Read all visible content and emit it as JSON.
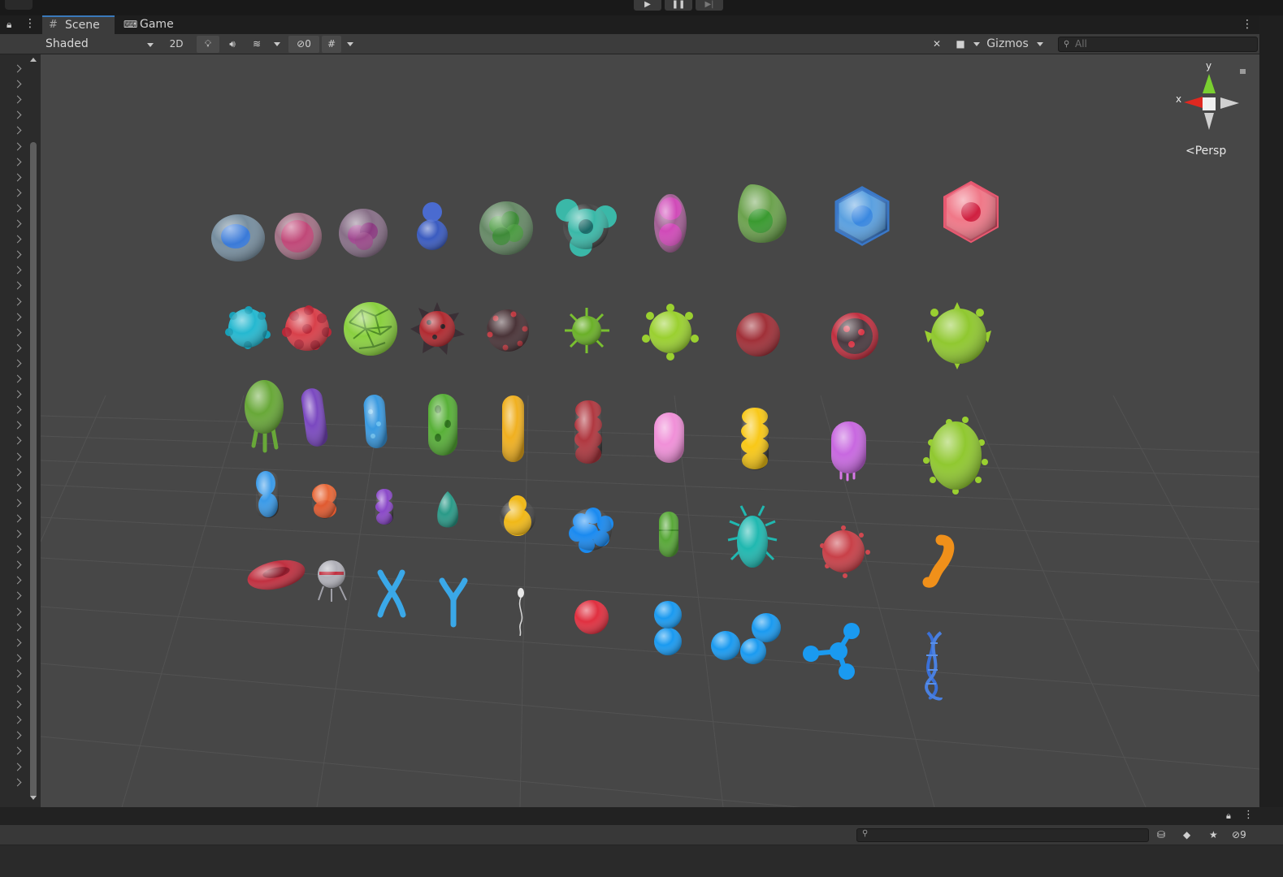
{
  "top": {
    "logo_text": "",
    "play_icons": {
      "play": "play-icon",
      "pause": "pause-icon",
      "step": "step-icon"
    }
  },
  "tabs": [
    {
      "label": "Scene",
      "icon": "grid-icon"
    },
    {
      "label": "Game",
      "icon": "gamepad-icon"
    }
  ],
  "toolbar": {
    "shading_mode": "Shaded",
    "mode_2d": "2D",
    "hidden_count": "0",
    "gizmos_label": "Gizmos",
    "search_placeholder": "All"
  },
  "gizmo": {
    "x_label": "x",
    "y_label": "y",
    "projection": "Persp"
  },
  "bottom": {
    "hidden_count": "9",
    "search_placeholder": ""
  },
  "colors": {
    "accent": "#3a79bb",
    "scene_bg": "#474747",
    "toolbar_bg": "#3c3c3c"
  },
  "scene_objects": [
    {
      "name": "blue-cell",
      "color": "#4a86d8"
    },
    {
      "name": "pink-cell",
      "color": "#d0608a"
    },
    {
      "name": "purple-cell",
      "color": "#a05a9a"
    },
    {
      "name": "blue-snowman-cell",
      "color": "#3a5bc0"
    },
    {
      "name": "green-cluster-cell",
      "color": "#5aa85a"
    },
    {
      "name": "teal-tri-cell",
      "color": "#3ab8a8"
    },
    {
      "name": "pink-double-cell",
      "color": "#d055b8"
    },
    {
      "name": "green-drop-cell",
      "color": "#55a845"
    },
    {
      "name": "blue-hex-cell",
      "color": "#4a90d8"
    },
    {
      "name": "pink-hex-cell",
      "color": "#f07080"
    },
    {
      "name": "cyan-bumpy-virus",
      "color": "#25b8d0"
    },
    {
      "name": "red-bumpy-virus",
      "color": "#d0404a"
    },
    {
      "name": "green-mesh-virus",
      "color": "#7ec83a"
    },
    {
      "name": "red-spiky-virus",
      "color": "#b02a30"
    },
    {
      "name": "dark-red-virus",
      "color": "#5a3a3e"
    },
    {
      "name": "green-spike-virus",
      "color": "#7ac030"
    },
    {
      "name": "lime-virus",
      "color": "#9ad030"
    },
    {
      "name": "dark-red-sphere",
      "color": "#a03038"
    },
    {
      "name": "red-corona-virus",
      "color": "#c03040"
    },
    {
      "name": "lime-big-virus",
      "color": "#90c830"
    },
    {
      "name": "green-jelly-bacteria",
      "color": "#68a838"
    },
    {
      "name": "purple-rod",
      "color": "#7a48c0"
    },
    {
      "name": "blue-rod",
      "color": "#3a9ae0"
    },
    {
      "name": "green-spotted-rod",
      "color": "#58b038"
    },
    {
      "name": "yellow-rod",
      "color": "#f0b020"
    },
    {
      "name": "red-chain",
      "color": "#b03840"
    },
    {
      "name": "pink-rod",
      "color": "#f090d8"
    },
    {
      "name": "yellow-chain",
      "color": "#f8c818"
    },
    {
      "name": "violet-jelly",
      "color": "#c868e0"
    },
    {
      "name": "lime-oval-bacteria",
      "color": "#9ad030"
    },
    {
      "name": "blue-duo",
      "color": "#3a9ae8"
    },
    {
      "name": "orange-duo",
      "color": "#e86838"
    },
    {
      "name": "purple-trio",
      "color": "#8a48c8"
    },
    {
      "name": "teal-drop",
      "color": "#2a9a88"
    },
    {
      "name": "yellow-snowman",
      "color": "#f0b818"
    },
    {
      "name": "blue-cluster",
      "color": "#1a8af0"
    },
    {
      "name": "green-pill",
      "color": "#58a838"
    },
    {
      "name": "teal-bug",
      "color": "#20b8b0"
    },
    {
      "name": "red-spore",
      "color": "#d04850"
    },
    {
      "name": "orange-worm",
      "color": "#f0901a"
    },
    {
      "name": "red-blood-cell",
      "color": "#c03040"
    },
    {
      "name": "nanobot",
      "color": "#b0b0b8"
    },
    {
      "name": "x-chromosome",
      "color": "#3aa8e8"
    },
    {
      "name": "y-chromosome",
      "color": "#3aa8e8"
    },
    {
      "name": "sperm-cell",
      "color": "#d8d8d8"
    },
    {
      "name": "red-sphere",
      "color": "#e03040"
    },
    {
      "name": "blue-two-atoms",
      "color": "#1a9af0"
    },
    {
      "name": "blue-three-atoms",
      "color": "#1a9af0"
    },
    {
      "name": "blue-molecule",
      "color": "#1a9af0"
    },
    {
      "name": "dna-helix",
      "color": "#3a70d8"
    }
  ]
}
